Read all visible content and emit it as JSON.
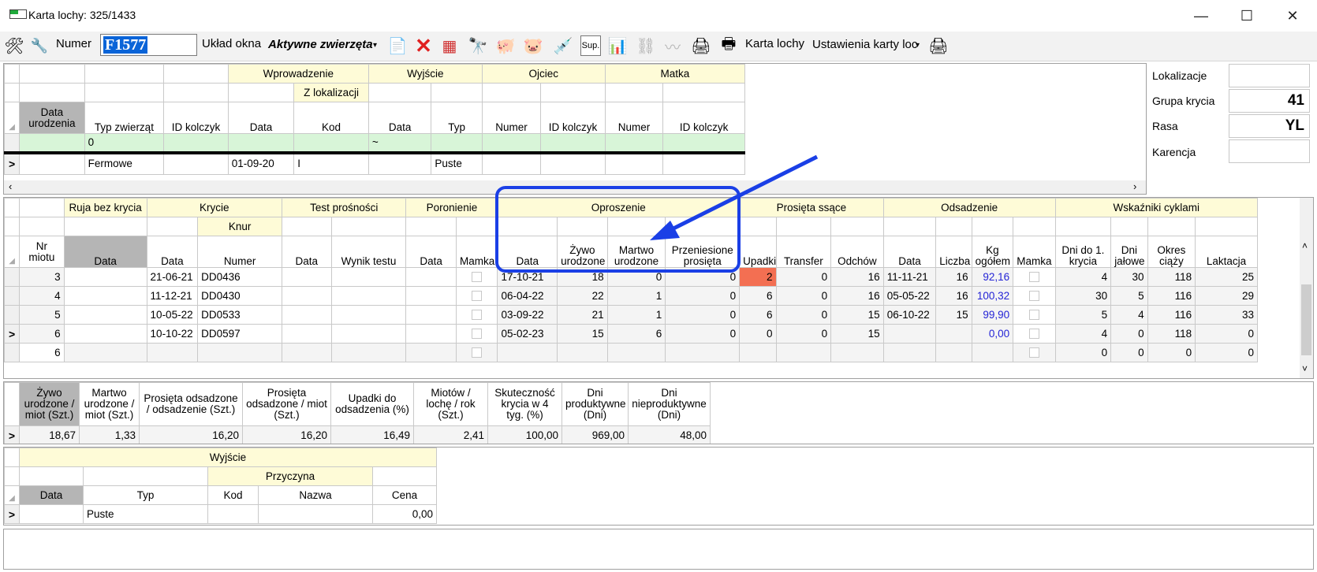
{
  "window": {
    "title": "Karta lochy: 325/1433",
    "minimize": "—",
    "maximize": "☐",
    "close": "✕"
  },
  "toolbar": {
    "numer_label": "Numer",
    "numer_value": "F1577",
    "uklad_label": "Układ okna",
    "uklad_value": "Aktywne zwierzęta",
    "sup_label": "Sup.",
    "karta_label": "Karta lochy",
    "ustawienia_value": "Ustawienia karty loc"
  },
  "top_grid": {
    "groups": {
      "wprowadzenie": "Wprowadzenie",
      "z_lokalizacji": "Z lokalizacji",
      "wyjscie": "Wyjście",
      "ojciec": "Ojciec",
      "matka": "Matka"
    },
    "columns": [
      "Data urodzenia",
      "Typ zwierząt",
      "ID kolczyk",
      "Data",
      "Kod",
      "Data",
      "Typ",
      "Numer",
      "ID kolczyk",
      "Numer",
      "ID kolczyk"
    ],
    "filter_row": [
      "",
      "0",
      "",
      "",
      "",
      "~",
      "",
      "",
      "",
      "",
      ""
    ],
    "data_row": [
      "",
      "Fermowe",
      "",
      "01-09-20",
      "I",
      "",
      "Puste",
      "",
      "",
      "",
      ""
    ],
    "row_indicator": ">"
  },
  "info_panel": {
    "lokalizacje_label": "Lokalizacje",
    "lokalizacje_value": "",
    "grupa_label": "Grupa krycia",
    "grupa_value": "41",
    "rasa_label": "Rasa",
    "rasa_value": "YL",
    "karencja_label": "Karencja",
    "karencja_value": ""
  },
  "litter_grid": {
    "groups": {
      "ruja": "Ruja bez krycia",
      "krycie": "Krycie",
      "knur": "Knur",
      "test": "Test prośności",
      "poronienie": "Poronienie",
      "oproszenie": "Oproszenie",
      "prosieta": "Prosięta ssące",
      "odsadzenie": "Odsadzenie",
      "wskazniki": "Wskaźniki cyklami"
    },
    "columns": [
      "Nr miotu",
      "Data",
      "Data",
      "Numer",
      "Data",
      "Wynik testu",
      "Data",
      "Mamka",
      "Data",
      "Żywo urodzone",
      "Martwo urodzone",
      "Przeniesione prosięta",
      "Upadki",
      "Transfer",
      "Odchów",
      "Data",
      "Liczba",
      "Kg ogółem",
      "Mamka",
      "Dni do 1. krycia",
      "Dni jałowe",
      "Okres ciąży",
      "Laktacja"
    ],
    "rows": [
      {
        "ind": "",
        "nr": "3",
        "kr_data": "21-06-21",
        "knur": "DD0436",
        "op_data": "17-10-21",
        "zywo": "18",
        "martwo": "0",
        "przen": "0",
        "upadki": "2",
        "transfer": "0",
        "odchow": "16",
        "od_data": "11-11-21",
        "liczba": "16",
        "kg": "92,16",
        "dni1": "4",
        "jalowe": "30",
        "ciazy": "118",
        "laktacja": "25"
      },
      {
        "ind": "",
        "nr": "4",
        "kr_data": "11-12-21",
        "knur": "DD0430",
        "op_data": "06-04-22",
        "zywo": "22",
        "martwo": "1",
        "przen": "0",
        "upadki": "6",
        "transfer": "0",
        "odchow": "16",
        "od_data": "05-05-22",
        "liczba": "16",
        "kg": "100,32",
        "dni1": "30",
        "jalowe": "5",
        "ciazy": "116",
        "laktacja": "29"
      },
      {
        "ind": "",
        "nr": "5",
        "kr_data": "10-05-22",
        "knur": "DD0533",
        "op_data": "03-09-22",
        "zywo": "21",
        "martwo": "1",
        "przen": "0",
        "upadki": "6",
        "transfer": "0",
        "odchow": "15",
        "od_data": "06-10-22",
        "liczba": "15",
        "kg": "99,90",
        "dni1": "5",
        "jalowe": "4",
        "ciazy": "116",
        "laktacja": "33"
      },
      {
        "ind": ">",
        "nr": "6",
        "kr_data": "10-10-22",
        "knur": "DD0597",
        "op_data": "05-02-23",
        "zywo": "15",
        "martwo": "6",
        "przen": "0",
        "upadki": "0",
        "transfer": "0",
        "odchow": "15",
        "od_data": "",
        "liczba": "",
        "kg": "0,00",
        "dni1": "4",
        "jalowe": "0",
        "ciazy": "118",
        "laktacja": "0"
      },
      {
        "ind": "",
        "nr": "6",
        "kr_data": "",
        "knur": "",
        "op_data": "",
        "zywo": "",
        "martwo": "",
        "przen": "",
        "upadki": "",
        "transfer": "",
        "odchow": "",
        "od_data": "",
        "liczba": "",
        "kg": "",
        "dni1": "0",
        "jalowe": "0",
        "ciazy": "0",
        "laktacja": "0"
      }
    ]
  },
  "summary_grid": {
    "headers": [
      "Żywo urodzone / miot (Szt.)",
      "Martwo urodzone / miot (Szt.)",
      "Prosięta odsadzone / odsadzenie (Szt.)",
      "Prosięta odsadzone / miot (Szt.)",
      "Upadki do odsadzenia (%)",
      "Miotów / lochę / rok (Szt.)",
      "Skuteczność krycia w 4 tyg. (%)",
      "Dni produktywne (Dni)",
      "Dni nieproduktywne (Dni)"
    ],
    "values": [
      "18,67",
      "1,33",
      "16,20",
      "16,20",
      "16,49",
      "2,41",
      "100,00",
      "969,00",
      "48,00"
    ]
  },
  "exit_grid": {
    "wyjscie": "Wyjście",
    "przyczyna": "Przyczyna",
    "columns": [
      "Data",
      "Typ",
      "Kod",
      "Nazwa",
      "Cena"
    ],
    "row": [
      "",
      "Puste",
      "",
      "",
      "0,00"
    ]
  },
  "annotation": {
    "color": "#1a3fe6"
  }
}
